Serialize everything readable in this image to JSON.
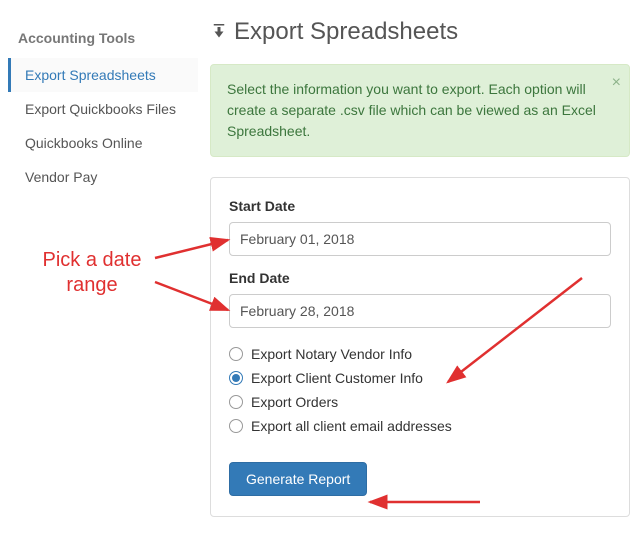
{
  "sidebar": {
    "title": "Accounting Tools",
    "items": [
      {
        "label": "Export Spreadsheets",
        "active": true
      },
      {
        "label": "Export Quickbooks Files",
        "active": false
      },
      {
        "label": "Quickbooks Online",
        "active": false
      },
      {
        "label": "Vendor Pay",
        "active": false
      }
    ]
  },
  "page": {
    "title": "Export Spreadsheets",
    "download_icon": "download-icon"
  },
  "alert": {
    "text": "Select the information you want to export. Each option will create a separate .csv file which can be viewed as an Excel Spreadsheet."
  },
  "form": {
    "start_label": "Start Date",
    "start_value": "February 01, 2018",
    "end_label": "End Date",
    "end_value": "February 28, 2018",
    "options": [
      {
        "label": "Export Notary Vendor Info",
        "selected": false
      },
      {
        "label": "Export Client Customer Info",
        "selected": true
      },
      {
        "label": "Export Orders",
        "selected": false
      },
      {
        "label": "Export all client email addresses",
        "selected": false
      }
    ],
    "button": "Generate Report"
  },
  "annotation": {
    "text": "Pick a date\nrange"
  }
}
